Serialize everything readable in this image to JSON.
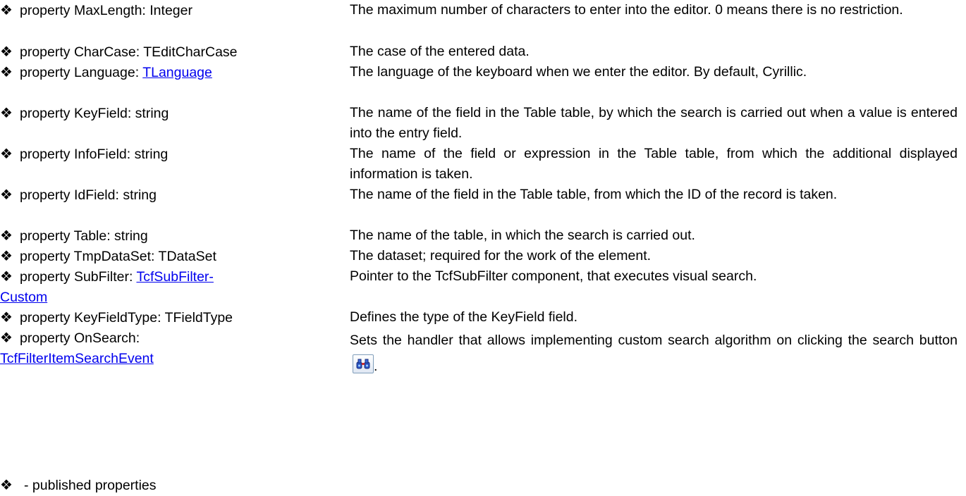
{
  "bullet": "❖",
  "properties": [
    {
      "prefix": "property MaxLength: Integer",
      "description": "The maximum number of characters to enter into the editor. 0 means there is no restriction."
    },
    {
      "prefix": "property CharCase: TEditCharCase",
      "description": "The case of the entered data."
    },
    {
      "prefix": "property Language: ",
      "link": "TLanguage",
      "description": "The language of the keyboard when we enter the editor. By default, Cyrillic."
    },
    {
      "prefix": "property KeyField: string",
      "description": "The name of the field in the Table table, by which the search is carried out when a value is entered into the entry field."
    },
    {
      "prefix": "property InfoField: string",
      "description": "The name of the field or expression in the Table table, from which the additional displayed information is taken."
    },
    {
      "prefix": "property IdField: string",
      "description": "The name of the field in the Table table, from which the ID of the record is taken."
    },
    {
      "prefix": "property Table: string",
      "description": "The name of the table, in which the search is carried out."
    },
    {
      "prefix": "property TmpDataSet: TDataSet",
      "description": "The dataset; required for the work of the element."
    },
    {
      "prefix": "property SubFilter: ",
      "link_line1": "TcfSubFilter-",
      "link_line2": "Custom",
      "description": "Pointer to the TcfSubFilter component, that executes visual search."
    },
    {
      "prefix": "property KeyFieldType: TFieldType",
      "description": "Defines the type of the KeyField field."
    },
    {
      "prefix": "property OnSearch:",
      "link": "TcfFilterItemSearchEvent",
      "description": "Sets the handler that allows implementing custom search algorithm on clicking the search button",
      "description_end": "."
    }
  ],
  "legend": "- published properties",
  "icons": {
    "search_button": "binoculars-icon"
  }
}
